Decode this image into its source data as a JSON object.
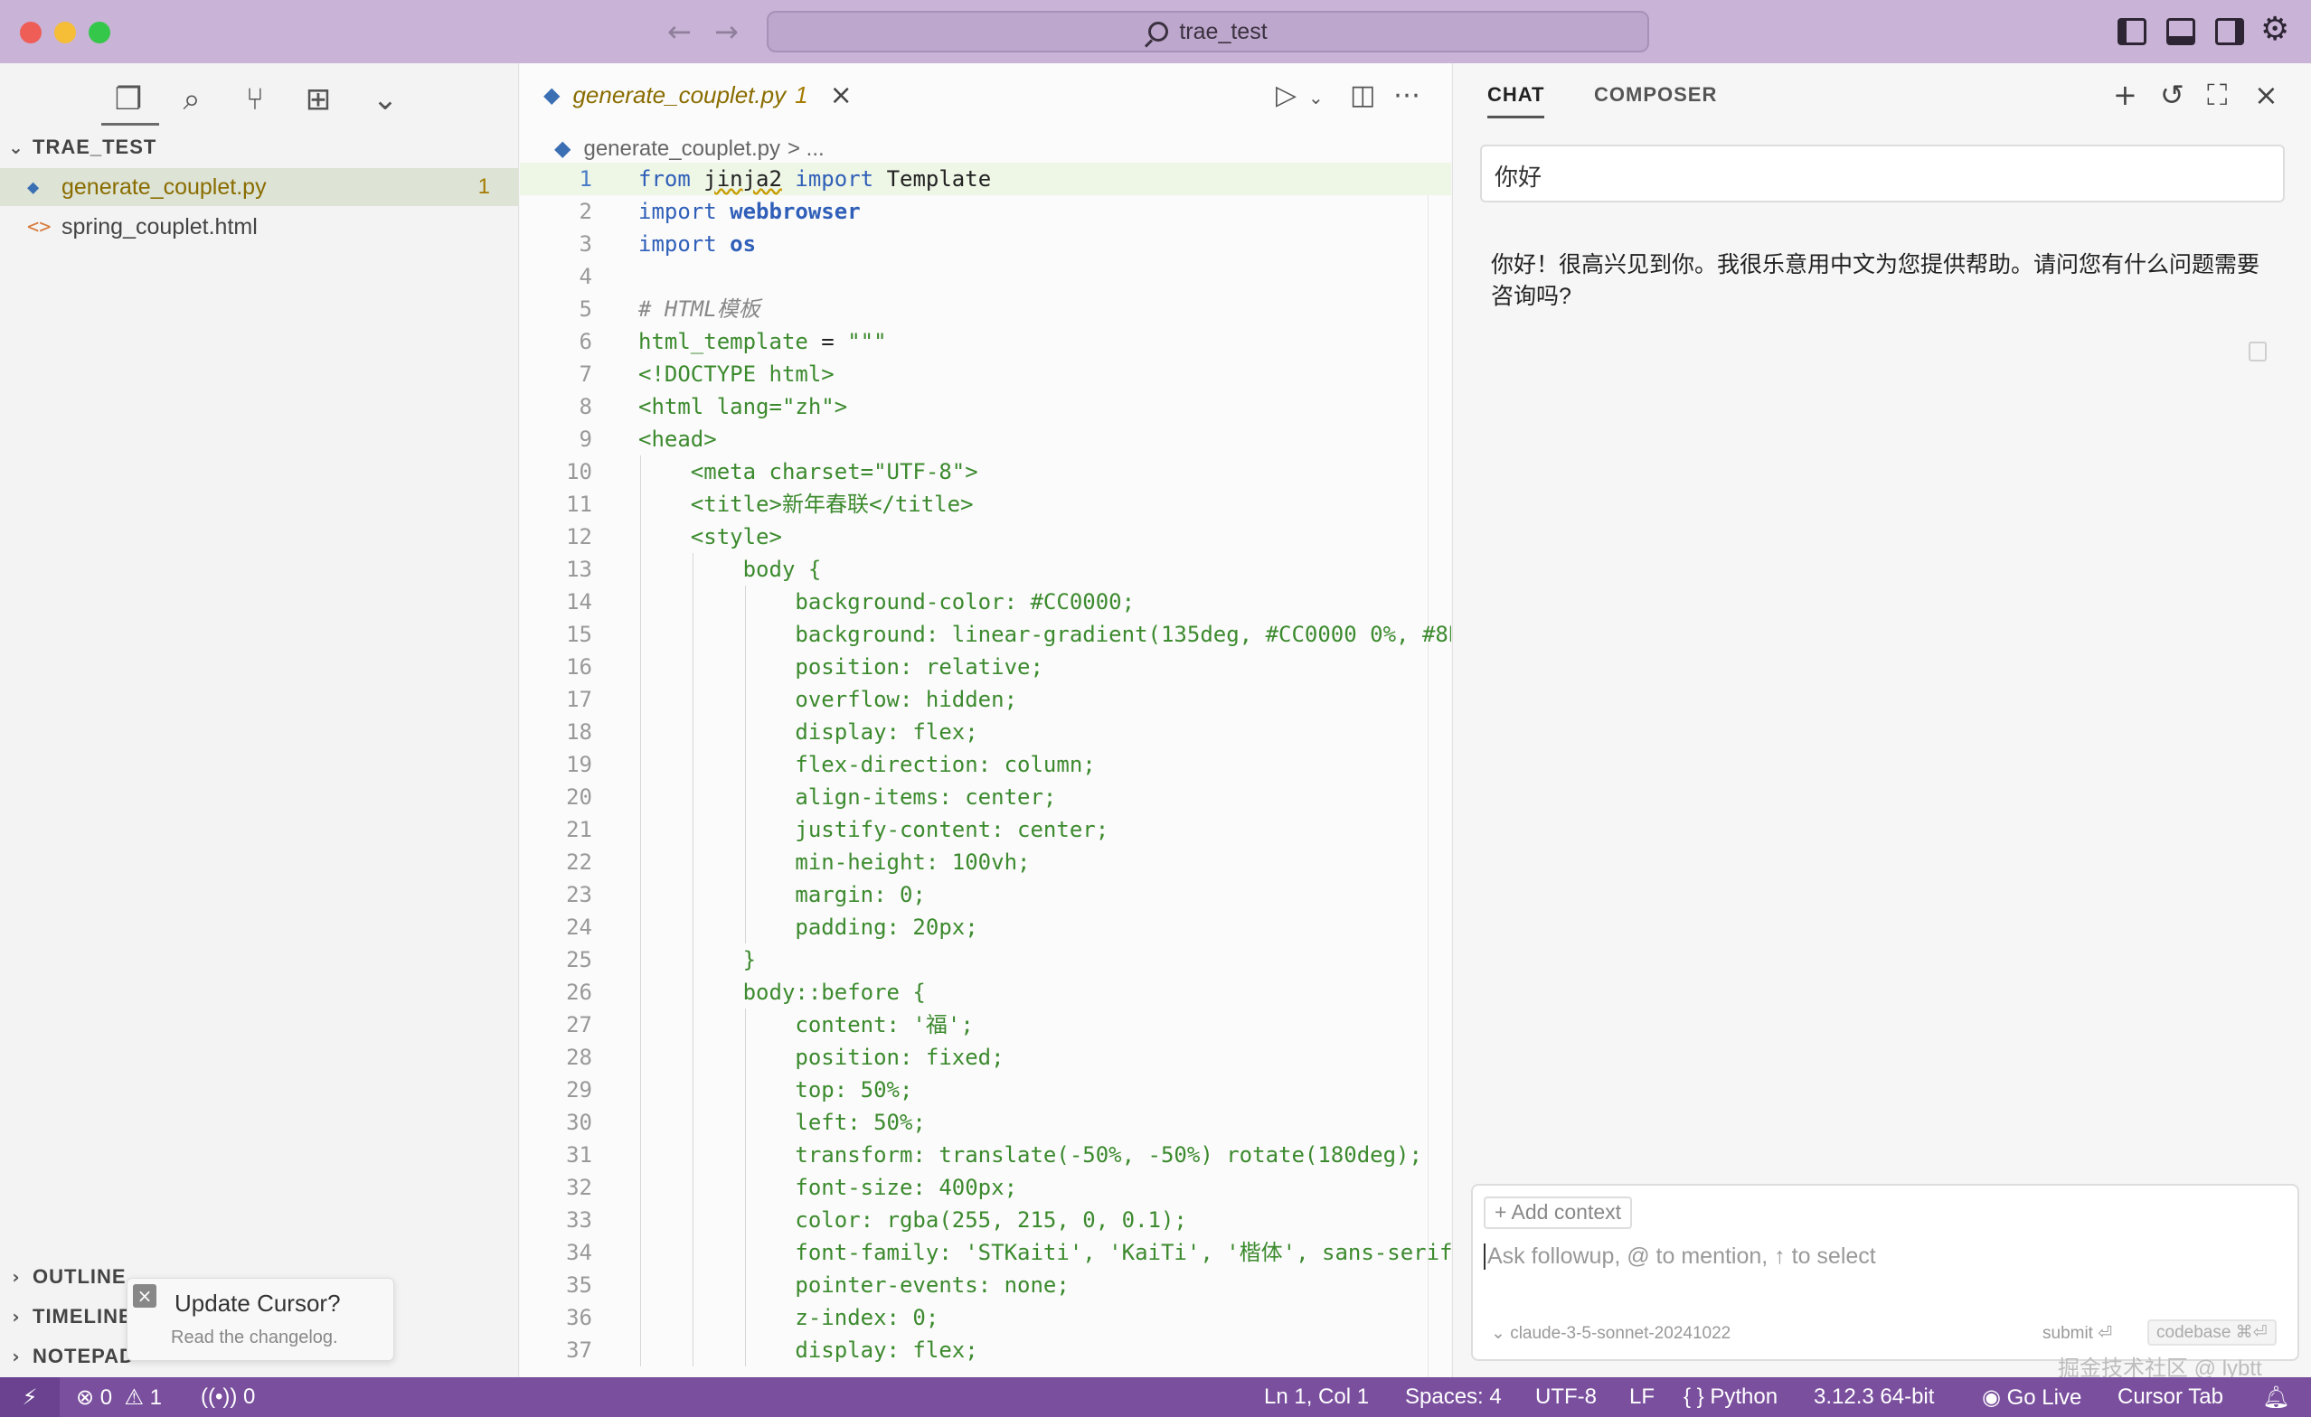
{
  "window": {
    "title": "trae_test",
    "colors": {
      "titlebar": "#c9b3d6",
      "close": "#ee5e57",
      "minimize": "#f6bd37",
      "maximize": "#35c749"
    }
  },
  "sidebar": {
    "activity_icons": [
      "files-icon",
      "search-icon",
      "source-control-icon",
      "extensions-icon",
      "chevron-down-icon"
    ],
    "explorer": {
      "folder_name": "TRAE_TEST",
      "files": [
        {
          "name": "generate_couplet.py",
          "badge": "1",
          "icon": "python-file-icon"
        },
        {
          "name": "spring_couplet.html",
          "icon": "html-file-icon"
        }
      ]
    },
    "sections": {
      "outline": "OUTLINE",
      "timeline": "TIMELINE",
      "notepad": "NOTEPAD"
    },
    "toast": {
      "title": "Update Cursor?",
      "subtitle": "Read the changelog."
    }
  },
  "editor": {
    "tab": {
      "name": "generate_couplet.py",
      "badge": "1"
    },
    "breadcrumb": {
      "file": "generate_couplet.py",
      "more": "> ..."
    },
    "lines": [
      "from jinja2 import Template",
      "import webbrowser",
      "import os",
      "",
      "# HTML模板",
      "html_template = \"\"\"",
      "<!DOCTYPE html>",
      "<html lang=\"zh\">",
      "<head>",
      "    <meta charset=\"UTF-8\">",
      "    <title>新年春联</title>",
      "    <style>",
      "        body {",
      "            background-color: #CC0000;",
      "            background: linear-gradient(135deg, #CC0000 0%, #8B",
      "            position: relative;",
      "            overflow: hidden;",
      "            display: flex;",
      "            flex-direction: column;",
      "            align-items: center;",
      "            justify-content: center;",
      "            min-height: 100vh;",
      "            margin: 0;",
      "            padding: 20px;",
      "        }",
      "        body::before {",
      "            content: '福';",
      "            position: fixed;",
      "            top: 50%;",
      "            left: 50%;",
      "            transform: translate(-50%, -50%) rotate(180deg);",
      "            font-size: 400px;",
      "            color: rgba(255, 215, 0, 0.1);",
      "            font-family: 'STKaiti', 'KaiTi', '楷体', sans-serif",
      "            pointer-events: none;",
      "            z-index: 0;",
      "            display: flex;"
    ]
  },
  "chat": {
    "tabs": [
      "CHAT",
      "COMPOSER"
    ],
    "user_message": "你好",
    "reply": "你好！很高兴见到你。我很乐意用中文为您提供帮助。请问您有什么问题需要咨询吗?",
    "input": {
      "add_context": "+ Add context",
      "placeholder": "Ask followup, @ to mention, ↑ to select",
      "model": "claude-3-5-sonnet-20241022",
      "submit": "submit ⏎",
      "codebase": "codebase ⌘⏎"
    },
    "watermark": "掘金技术社区 @ lybtt"
  },
  "statusbar": {
    "errors": "0",
    "warnings": "1",
    "ports": "0",
    "position": "Ln 1, Col 1",
    "spaces": "Spaces: 4",
    "encoding": "UTF-8",
    "eol": "LF",
    "language": "Python",
    "interpreter": "3.12.3 64-bit",
    "golive": "Go Live",
    "cursor_tab": "Cursor Tab",
    "color": "#7a4f9e"
  }
}
